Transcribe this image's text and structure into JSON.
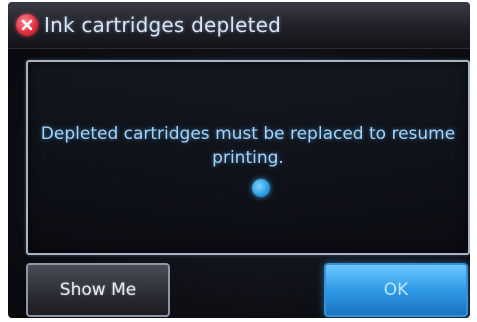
{
  "dialog": {
    "title": "Ink cartridges depleted",
    "status_icon": "error-x-icon",
    "message": "Depleted cartridges must be replaced to resume printing.",
    "busy_indicator_icon": "busy-dot-icon"
  },
  "buttons": {
    "show_me_label": "Show Me",
    "ok_label": "OK"
  },
  "colors": {
    "screen_background": "#0d0f15",
    "message_text": "#9fd4ff",
    "error_red": "#e2303f",
    "ok_button_blue": "#2f9be6",
    "frame_border": "#a8b4c4"
  }
}
